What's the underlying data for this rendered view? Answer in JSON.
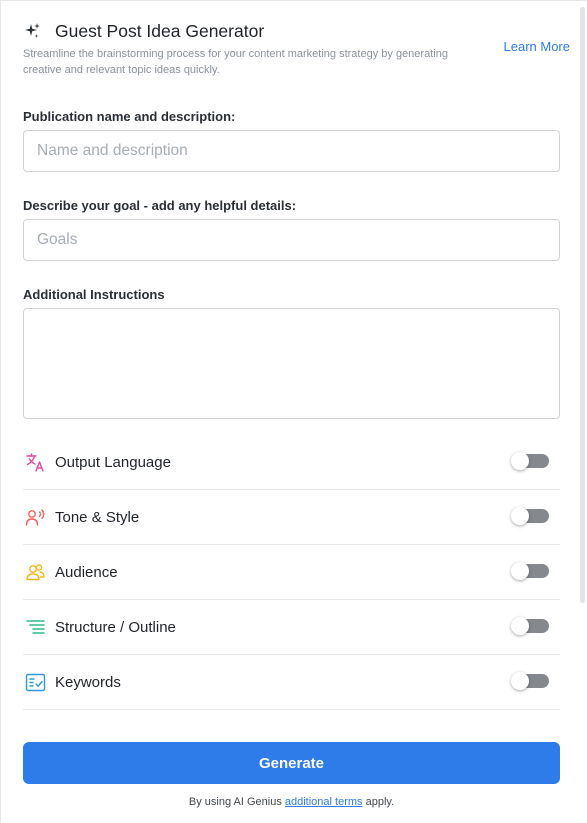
{
  "header": {
    "title": "Guest Post Idea Generator",
    "subtitle": "Streamline the brainstorming process for your content marketing strategy by generating creative and relevant topic ideas quickly.",
    "learn_more": "Learn More",
    "icon": "sparkle-icon"
  },
  "fields": {
    "publication": {
      "label": "Publication name and description:",
      "placeholder": "Name and description",
      "value": ""
    },
    "goal": {
      "label": "Describe your goal - add any helpful details:",
      "placeholder": "Goals",
      "value": ""
    },
    "instructions": {
      "label": "Additional Instructions",
      "value": ""
    }
  },
  "options": [
    {
      "label": "Output Language",
      "icon": "translate-icon",
      "color": "#e0489a",
      "enabled": false
    },
    {
      "label": "Tone & Style",
      "icon": "voice-person-icon",
      "color": "#f0655a",
      "enabled": false
    },
    {
      "label": "Audience",
      "icon": "people-icon",
      "color": "#f1b721",
      "enabled": false
    },
    {
      "label": "Structure / Outline",
      "icon": "outline-list-icon",
      "color": "#2fb98a",
      "enabled": false
    },
    {
      "label": "Keywords",
      "icon": "keyword-checklist-icon",
      "color": "#2f98e0",
      "enabled": false
    }
  ],
  "actions": {
    "generate": "Generate"
  },
  "footer": {
    "prefix": "By using AI Genius ",
    "link": "additional terms",
    "suffix": " apply."
  },
  "colors": {
    "accent": "#2e7bea",
    "link": "#2d7be5",
    "toggle_off": "#85898e"
  }
}
